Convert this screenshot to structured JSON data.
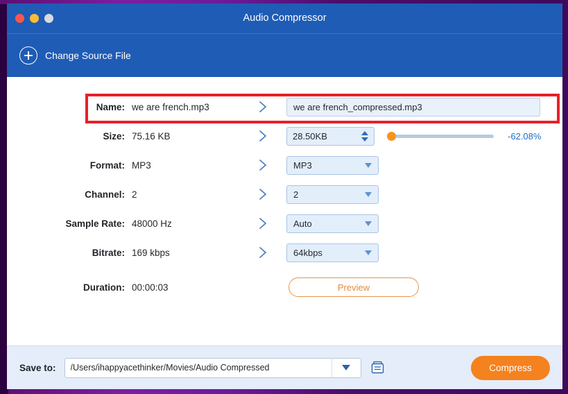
{
  "window": {
    "title": "Audio Compressor",
    "traffic_lights": [
      "close",
      "minimize",
      "maximize"
    ]
  },
  "source_bar": {
    "label": "Change Source File",
    "icon": "plus-circle-icon"
  },
  "rows": {
    "name": {
      "label": "Name:",
      "source_value": "we are french.mp3",
      "output_value": "we are french_compressed.mp3"
    },
    "size": {
      "label": "Size:",
      "source_value": "75.16 KB",
      "output_value": "28.50KB",
      "slider_percent": 0,
      "reduction": "-62.08%"
    },
    "format": {
      "label": "Format:",
      "source_value": "MP3",
      "output_value": "MP3"
    },
    "channel": {
      "label": "Channel:",
      "source_value": "2",
      "output_value": "2"
    },
    "sample_rate": {
      "label": "Sample Rate:",
      "source_value": "48000 Hz",
      "output_value": "Auto"
    },
    "bitrate": {
      "label": "Bitrate:",
      "source_value": "169 kbps",
      "output_value": "64kbps"
    },
    "duration": {
      "label": "Duration:",
      "source_value": "00:00:03",
      "preview_label": "Preview"
    }
  },
  "bottom_bar": {
    "save_to_label": "Save to:",
    "path_value": "/Users/ihappyacethinker/Movies/Audio Compressed",
    "compress_label": "Compress"
  },
  "colors": {
    "title_bar": "#1f5cb5",
    "accent_orange": "#f4821f",
    "highlight_red": "#e8202a",
    "link_blue": "#1f6fc4"
  }
}
